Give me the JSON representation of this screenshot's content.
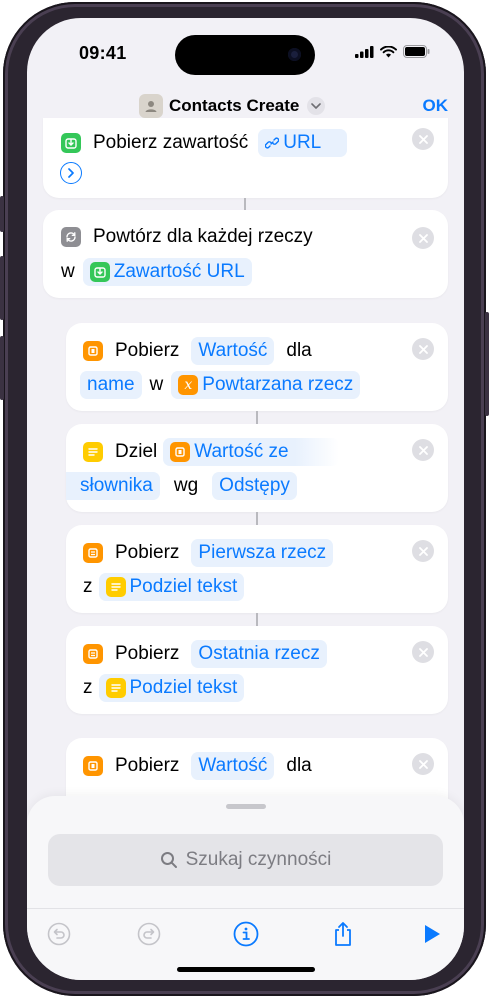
{
  "status": {
    "time": "09:41"
  },
  "nav": {
    "title": "Contacts Create",
    "ok": "OK"
  },
  "actions": {
    "a1": {
      "label": "Pobierz zawartość",
      "token": "URL"
    },
    "a2": {
      "label": "Powtórz dla każdej rzeczy",
      "w": "w",
      "token": "Zawartość URL"
    },
    "a3": {
      "label": "Pobierz",
      "token1": "Wartość",
      "dla": "dla",
      "token2": "name",
      "w": "w",
      "token3": "Powtarzana rzecz"
    },
    "a4": {
      "label": "Dziel",
      "token1a": "Wartość ze",
      "token1b": "słownika",
      "wg": "wg",
      "token2": "Odstępy"
    },
    "a5": {
      "label": "Pobierz",
      "token1": "Pierwsza rzecz",
      "z": "z",
      "token2": "Podziel tekst"
    },
    "a6": {
      "label": "Pobierz",
      "token1": "Ostatnia rzecz",
      "z": "z",
      "token2": "Podziel tekst"
    },
    "a7": {
      "label": "Pobierz",
      "token1": "Wartość",
      "dla": "dla"
    }
  },
  "search": {
    "placeholder": "Szukaj czynności"
  },
  "colors": {
    "accent": "#0a7aff",
    "orange": "#ff9500",
    "green": "#34c759",
    "yellow": "#ffcc00"
  },
  "icons": [
    "undo-icon",
    "redo-icon",
    "info-icon",
    "share-icon",
    "play-icon"
  ]
}
